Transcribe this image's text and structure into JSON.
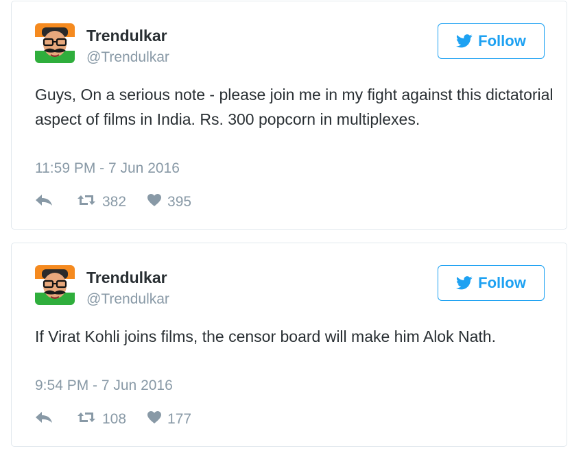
{
  "colors": {
    "accent": "#1da1f2",
    "text": "#292f33",
    "muted": "#8899a6",
    "border": "#e1e8ed"
  },
  "tweets": [
    {
      "author": "Trendulkar",
      "handle": "@Trendulkar",
      "follow_label": "Follow",
      "text": "Guys, On a serious note - please join me in my fight against this dictatorial aspect of films in India. Rs. 300 popcorn in multiplexes.",
      "timestamp": "11:59 PM - 7 Jun 2016",
      "retweets": "382",
      "likes": "395",
      "icons": {
        "reply": "reply-icon",
        "retweet": "retweet-icon",
        "like": "heart-icon",
        "follow": "twitter-bird-icon"
      }
    },
    {
      "author": "Trendulkar",
      "handle": "@Trendulkar",
      "follow_label": "Follow",
      "text": "If Virat Kohli joins films, the censor board will make him Alok Nath.",
      "timestamp": "9:54 PM - 7 Jun 2016",
      "retweets": "108",
      "likes": "177",
      "icons": {
        "reply": "reply-icon",
        "retweet": "retweet-icon",
        "like": "heart-icon",
        "follow": "twitter-bird-icon"
      }
    }
  ]
}
